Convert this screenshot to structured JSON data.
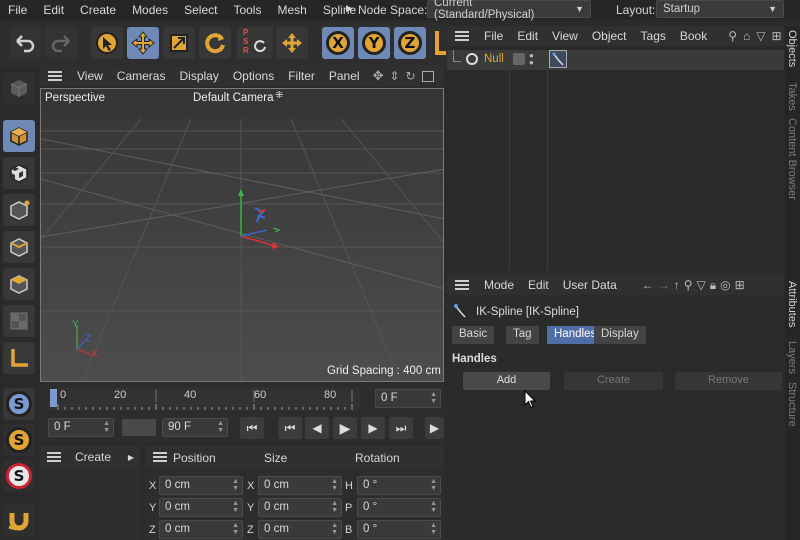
{
  "menubar": {
    "items": [
      "File",
      "Edit",
      "Create",
      "Modes",
      "Select",
      "Tools",
      "Mesh",
      "Spline"
    ],
    "node_space_label": "Node Space:",
    "node_space_value": "Current (Standard/Physical)",
    "layout_label": "Layout:",
    "layout_value": "Startup"
  },
  "toolbar": {
    "axes": [
      "X",
      "Y",
      "Z"
    ],
    "psr_letters": [
      "P",
      "S",
      "R"
    ]
  },
  "viewport": {
    "menu": [
      "View",
      "Cameras",
      "Display",
      "Options",
      "Filter",
      "Panel"
    ],
    "view_name": "Perspective",
    "camera": "Default Camera",
    "grid_spacing": "Grid Spacing : 400 cm",
    "axis_letters": [
      "Y",
      "Z",
      "X"
    ]
  },
  "timeline": {
    "ticks": [
      "0",
      "20",
      "40",
      "60",
      "80"
    ],
    "current_frame": "0 F",
    "start_frame": "0 F",
    "end_frame": "90 F",
    "end_display": "0 F"
  },
  "create_panel": {
    "label": "Create"
  },
  "coords": {
    "headers": [
      "Position",
      "Size",
      "Rotation"
    ],
    "rows": [
      {
        "pos_axis": "X",
        "pos": "0 cm",
        "size_axis": "X",
        "size": "0 cm",
        "rot_axis": "H",
        "rot": "0 °"
      },
      {
        "pos_axis": "Y",
        "pos": "0 cm",
        "size_axis": "Y",
        "size": "0 cm",
        "rot_axis": "P",
        "rot": "0 °"
      },
      {
        "pos_axis": "Z",
        "pos": "0 cm",
        "size_axis": "Z",
        "size": "0 cm",
        "rot_axis": "B",
        "rot": "0 °"
      }
    ]
  },
  "objects_panel": {
    "menu": [
      "File",
      "Edit",
      "View",
      "Object",
      "Tags",
      "Book"
    ],
    "object_name": "Null"
  },
  "attributes_panel": {
    "menu": [
      "Mode",
      "Edit",
      "User Data"
    ],
    "title": "IK-Spline [IK-Spline]",
    "tabs": [
      "Basic",
      "Tag",
      "Handles",
      "Display"
    ],
    "active_tab": "Handles",
    "section": "Handles",
    "buttons": {
      "add": "Add",
      "create": "Create",
      "remove": "Remove"
    }
  },
  "side_tabs": [
    "Objects",
    "Takes",
    "Content Browser",
    "Attributes",
    "Layers",
    "Structure"
  ],
  "colors": {
    "accent": "#4f6ea6",
    "orange": "#e1a535",
    "active_tool": "#6f89b6"
  }
}
